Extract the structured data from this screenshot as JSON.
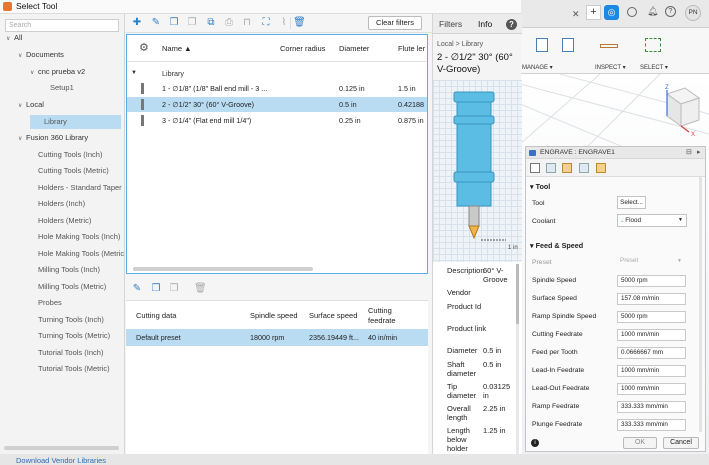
{
  "dialog": {
    "title": "Select Tool",
    "search_placeholder": "Search",
    "vendor_link": "Download Vendor Libraries"
  },
  "tree": [
    {
      "label": "All",
      "indent": 0,
      "expanded": true
    },
    {
      "label": "Documents",
      "indent": 1,
      "expanded": true
    },
    {
      "label": "cnc prueba v2",
      "indent": 2,
      "expanded": true
    },
    {
      "label": "Setup1",
      "indent": 3
    },
    {
      "label": "Local",
      "indent": 1,
      "expanded": true
    },
    {
      "label": "Library",
      "indent": 2,
      "selected": true
    },
    {
      "label": "Fusion 360 Library",
      "indent": 1,
      "expanded": true
    },
    {
      "label": "Cutting Tools (Inch)",
      "indent": 2
    },
    {
      "label": "Cutting Tools (Metric)",
      "indent": 2
    },
    {
      "label": "Holders - Standard Taper",
      "indent": 2
    },
    {
      "label": "Holders (Inch)",
      "indent": 2
    },
    {
      "label": "Holders (Metric)",
      "indent": 2
    },
    {
      "label": "Hole Making Tools (Inch)",
      "indent": 2
    },
    {
      "label": "Hole Making Tools (Metric",
      "indent": 2
    },
    {
      "label": "Milling Tools (Inch)",
      "indent": 2
    },
    {
      "label": "Milling Tools (Metric)",
      "indent": 2
    },
    {
      "label": "Probes",
      "indent": 2
    },
    {
      "label": "Turning Tools (Inch)",
      "indent": 2
    },
    {
      "label": "Turning Tools (Metric)",
      "indent": 2
    },
    {
      "label": "Tutorial Tools (Inch)",
      "indent": 2
    },
    {
      "label": "Tutorial Tools (Metric)",
      "indent": 2
    }
  ],
  "toolbar": {
    "clear_filters": "Clear filters"
  },
  "tool_table": {
    "headers": {
      "name": "Name",
      "corner_radius": "Corner radius",
      "diameter": "Diameter",
      "flute": "Flute ler"
    },
    "group": "Library",
    "rows": [
      {
        "name": "1 - ∅1/8\" (1/8\" Ball end mill - 3 ...",
        "diameter": "0.125 in",
        "flute": "1.5 in",
        "selected": false
      },
      {
        "name": "2 - ∅1/2\" 30° (60° V-Groove)",
        "diameter": "0.5 in",
        "flute": "0.42188",
        "selected": true
      },
      {
        "name": "3 - ∅1/4\" (Flat end mill 1/4\")",
        "diameter": "0.25 in",
        "flute": "0.875 in",
        "selected": false
      }
    ]
  },
  "preset_table": {
    "headers": {
      "cutting_data": "Cutting data",
      "spindle": "Spindle speed",
      "surface": "Surface speed",
      "feedrate_1": "Cutting",
      "feedrate_2": "feedrate"
    },
    "row": {
      "name": "Default preset",
      "spindle": "18000 rpm",
      "surface": "2356.19449 ft...",
      "feedrate": "40 in/min"
    }
  },
  "info_panel": {
    "tab_filters": "Filters",
    "tab_info": "Info",
    "help": "?",
    "breadcrumb": "Local  >  Library",
    "tool_title": "2 - ∅1/2\" 30° (60° V-Groove)",
    "dim_label": "1 in",
    "props": [
      {
        "label": "Description",
        "value": "60° V-Groove"
      },
      {
        "label": "Vendor",
        "value": ""
      },
      {
        "label": "Product Id",
        "value": ""
      },
      {
        "label": "Product link",
        "value": ""
      },
      {
        "label": "Diameter",
        "value": "0.5 in"
      },
      {
        "label": "Shaft diameter",
        "value": "0.5 in"
      },
      {
        "label": "Tip diameter",
        "value": "0.03125 in"
      },
      {
        "label": "Overall length",
        "value": "2.25 in"
      },
      {
        "label": "Length below holder",
        "value": "1.25 in"
      }
    ]
  },
  "background_app": {
    "toolbar_labels": [
      "MANAGE",
      "INSPECT",
      "SELECT"
    ],
    "user_initials": "PN"
  },
  "engrave_panel": {
    "title": "ENGRAVE : ENGRAVE1",
    "tool_section": "Tool",
    "tool_label": "Tool",
    "tool_button": "Select...",
    "coolant_label": "Coolant",
    "coolant_value": "Flood",
    "feed_section": "Feed & Speed",
    "preset_label": "Preset",
    "preset_value": "Preset",
    "fields": [
      {
        "label": "Spindle Speed",
        "value": "5000 rpm"
      },
      {
        "label": "Surface Speed",
        "value": "157.08 m/min"
      },
      {
        "label": "Ramp Spindle Speed",
        "value": "5000 rpm"
      },
      {
        "label": "Cutting Feedrate",
        "value": "1000 mm/min"
      },
      {
        "label": "Feed per Tooth",
        "value": "0.0666667 mm"
      },
      {
        "label": "Lead-In Feedrate",
        "value": "1000 mm/min"
      },
      {
        "label": "Lead-Out Feedrate",
        "value": "1000 mm/min"
      },
      {
        "label": "Ramp Feedrate",
        "value": "333.333 mm/min"
      },
      {
        "label": "Plunge Feedrate",
        "value": "333.333 mm/min"
      }
    ],
    "ok": "OK",
    "cancel": "Cancel"
  },
  "colors": {
    "accent": "#2f7fc4",
    "selection": "#b9dcf3",
    "tool_body": "#5bbde3"
  }
}
